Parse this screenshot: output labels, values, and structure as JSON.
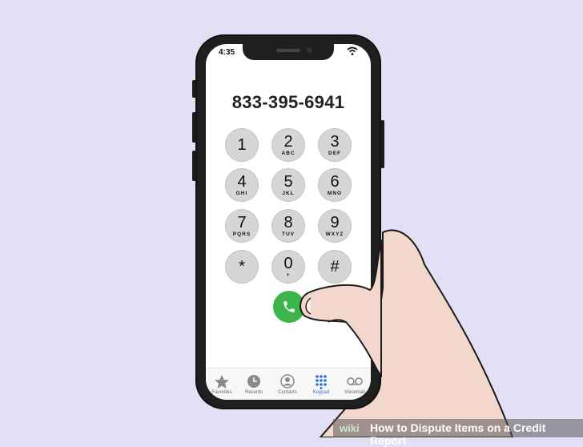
{
  "status_bar": {
    "time": "4:35"
  },
  "dialer": {
    "number": "833-395-6941",
    "keys": [
      {
        "digit": "1",
        "letters": ""
      },
      {
        "digit": "2",
        "letters": "ABC"
      },
      {
        "digit": "3",
        "letters": "DEF"
      },
      {
        "digit": "4",
        "letters": "GHI"
      },
      {
        "digit": "5",
        "letters": "JKL"
      },
      {
        "digit": "6",
        "letters": "MNO"
      },
      {
        "digit": "7",
        "letters": "PQRS"
      },
      {
        "digit": "8",
        "letters": "TUV"
      },
      {
        "digit": "9",
        "letters": "WXYZ"
      },
      {
        "digit": "*",
        "letters": ""
      },
      {
        "digit": "0",
        "letters": "+"
      },
      {
        "digit": "#",
        "letters": ""
      }
    ]
  },
  "tab_bar": {
    "tabs": [
      {
        "label": "Favorites",
        "icon": "star-icon"
      },
      {
        "label": "Recents",
        "icon": "clock-icon"
      },
      {
        "label": "Contacts",
        "icon": "person-icon"
      },
      {
        "label": "Keypad",
        "icon": "keypad-icon",
        "active": true
      },
      {
        "label": "Voicemail",
        "icon": "voicemail-icon"
      }
    ]
  },
  "watermark": {
    "logo": "wiki",
    "title": "How to Dispute Items on a Credit Report"
  },
  "colors": {
    "background": "#e3dff5",
    "call_button": "#3bb54a",
    "active_tab": "#2d6fd6",
    "key": "#d6d6d6"
  }
}
